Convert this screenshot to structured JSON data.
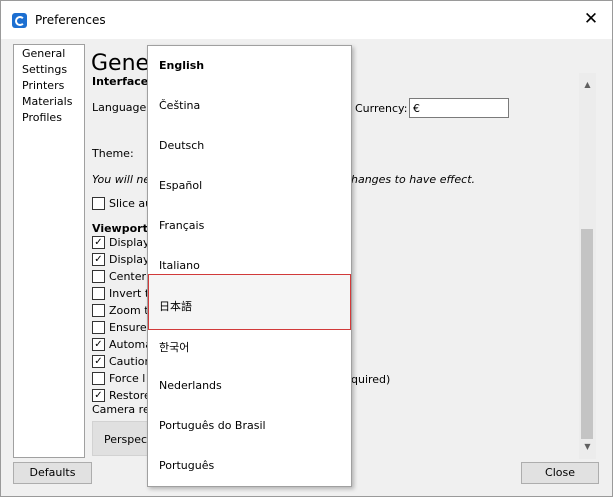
{
  "window": {
    "title": "Preferences",
    "close_symbol": "✕",
    "icon": "cura-logo-icon"
  },
  "sidebar": {
    "items": [
      "General",
      "Settings",
      "Printers",
      "Materials",
      "Profiles"
    ]
  },
  "content": {
    "heading": "Gener",
    "interface_label": "Interface",
    "language_label": "Language:",
    "currency_label": "Currency:",
    "currency_value": "€",
    "theme_label": "Theme:",
    "restart_note_start": "You will ne",
    "restart_note_end": "hanges to have effect.",
    "slice_label": "Slice au",
    "viewport_label": "Viewport",
    "checkboxes": [
      {
        "label": "Display",
        "checked": true
      },
      {
        "label": "Display",
        "checked": true
      },
      {
        "label": "Center",
        "checked": false
      },
      {
        "label": "Invert t",
        "checked": false
      },
      {
        "label": "Zoom t",
        "checked": false
      },
      {
        "label": "Ensure",
        "checked": false
      },
      {
        "label": "Automa",
        "checked": true
      },
      {
        "label": "Caution",
        "checked": true
      },
      {
        "label": "Force l",
        "checked": false
      },
      {
        "label": "Restore",
        "checked": true
      }
    ],
    "force_suffix": "quired)",
    "camera_label": "Camera ren",
    "perspective_label": "Perspect",
    "check_mark": "✓"
  },
  "buttons": {
    "defaults": "Defaults",
    "close": "Close"
  },
  "scrollbar": {
    "up_arrow": "▲",
    "down_arrow": "▼"
  },
  "language_dropdown": {
    "options": [
      "English",
      "Čeština",
      "Deutsch",
      "Español",
      "Français",
      "Italiano",
      "日本語",
      "한국어",
      "Nederlands",
      "Português do Brasil",
      "Português"
    ],
    "selected": "日本語"
  }
}
